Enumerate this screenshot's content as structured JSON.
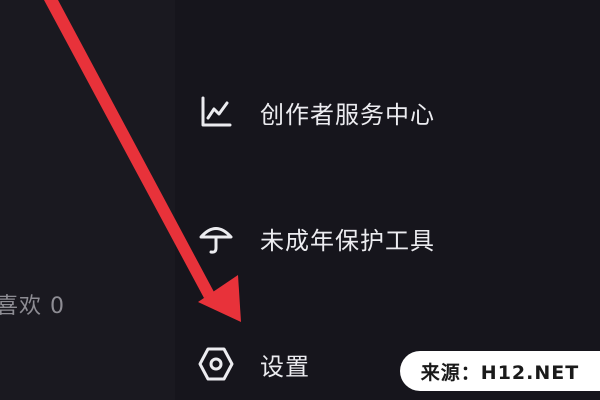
{
  "left_panel": {
    "likes_label": "喜欢 0"
  },
  "menu": {
    "items": [
      {
        "label": "创作者服务中心",
        "icon": "chart-line-icon"
      },
      {
        "label": "未成年保护工具",
        "icon": "umbrella-icon"
      },
      {
        "label": "设置",
        "icon": "hexagon-settings-icon"
      }
    ]
  },
  "annotation": {
    "arrow_color": "#e8323a"
  },
  "watermark": {
    "text": "来源：H12.NET"
  },
  "colors": {
    "background": "#15141b",
    "menu_text": "#ececf0",
    "muted_text": "#8e8d94"
  }
}
